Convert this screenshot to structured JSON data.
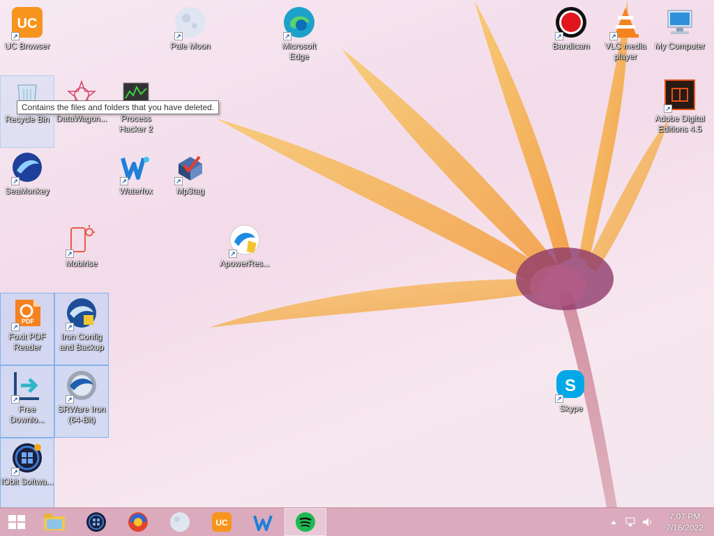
{
  "desktop": {
    "icons": {
      "uc_browser": "UC Browser",
      "pale_moon": "Pale Moon",
      "microsoft_edge": "Microsoft Edge",
      "bandicam": "Bandicam",
      "vlc": "VLC media player",
      "my_computer": "My Computer",
      "recycle_bin": "Recycle Bin",
      "datawagon": "DataWagon...",
      "process_hacker": "Process Hacker 2",
      "adobe_digital_editions": "Adobe Digital Editions 4.5",
      "seamonkey": "SeaMonkey",
      "waterfox": "Waterfox",
      "mp3tag": "Mp3tag",
      "mobirise": "Mobirise",
      "apowerrec": "ApowerRes...",
      "foxit": "Foxit PDF Reader",
      "iron_config": "Iron Config and Backup",
      "free_download": "Free Downlo...",
      "srware_iron": "SRWare Iron (64-Bit)",
      "iobit": "IObit Softwa...",
      "skype": "Skype"
    },
    "tooltip": "Contains the files and folders that you have deleted."
  },
  "taskbar": {
    "clock_time": "7:07 PM",
    "clock_date": "7/16/2022"
  },
  "colors": {
    "taskbar": "#d6a0b4",
    "selection": "#99ccff"
  }
}
